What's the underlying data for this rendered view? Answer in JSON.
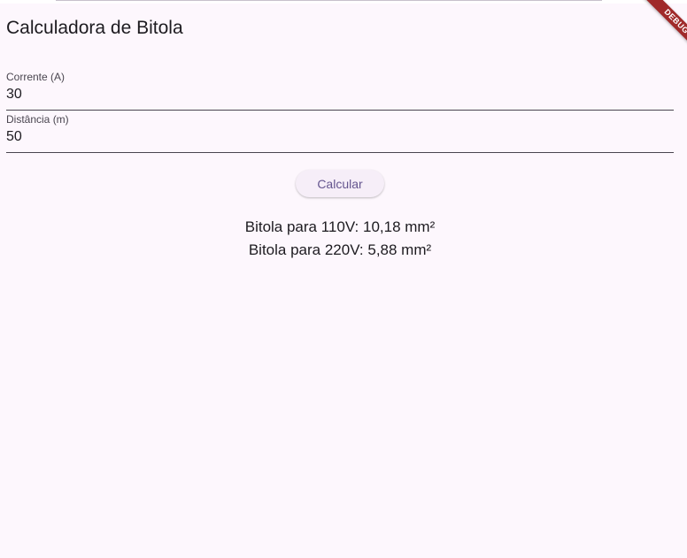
{
  "app": {
    "title": "Calculadora de Bitola"
  },
  "form": {
    "current": {
      "label": "Corrente (A)",
      "value": "30"
    },
    "distance": {
      "label": "Distância (m)",
      "value": "50"
    },
    "calculate_label": "Calcular"
  },
  "results": {
    "line_110": "Bitola para 110V: 10,18 mm²",
    "line_220": "Bitola para 220V: 5,88 mm²"
  },
  "debug_banner": {
    "label": "DEBUG"
  },
  "colors": {
    "background": "#fdf7fd",
    "button_text": "#65558f",
    "banner": "#a02a2a"
  }
}
